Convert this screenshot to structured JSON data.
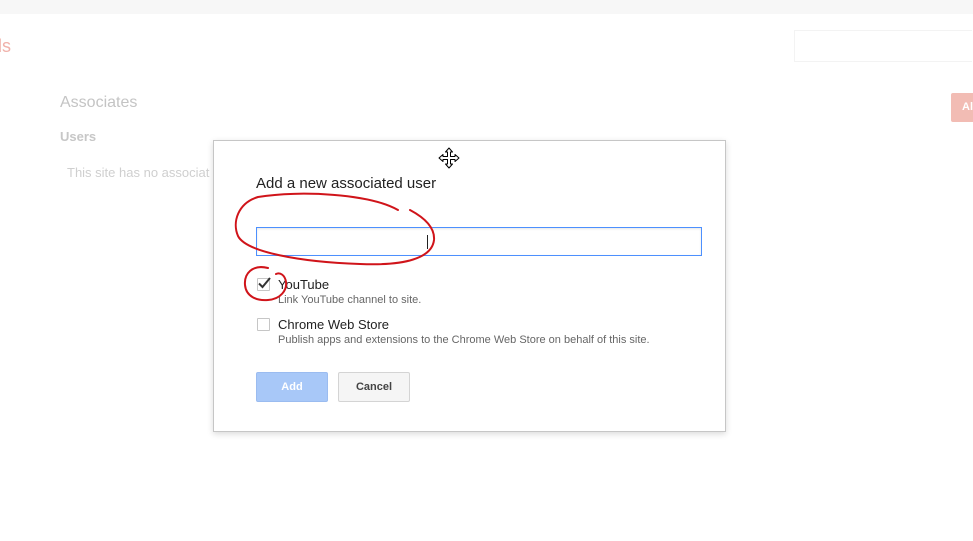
{
  "background": {
    "brand_fragment": "ls",
    "section_title": "Associates",
    "section_subtitle": "Users",
    "empty_text": "This site has no associat",
    "add_button_label": "Al"
  },
  "dialog": {
    "title": "Add a new associated user",
    "email_input": {
      "value": "",
      "placeholder": ""
    },
    "options": [
      {
        "label": "YouTube",
        "description": "Link YouTube channel to site.",
        "checked": true
      },
      {
        "label": "Chrome Web Store",
        "description": "Publish apps and extensions to the Chrome Web Store on behalf of this site.",
        "checked": false
      }
    ],
    "add_label": "Add",
    "cancel_label": "Cancel"
  },
  "colors": {
    "accent_blue": "#4d90fe",
    "annotation_red": "#d0141a",
    "disabled_blue": "#a8c8f8"
  },
  "icons": {
    "cursor": "move-cursor-icon",
    "checkmark": "checkmark-icon"
  }
}
